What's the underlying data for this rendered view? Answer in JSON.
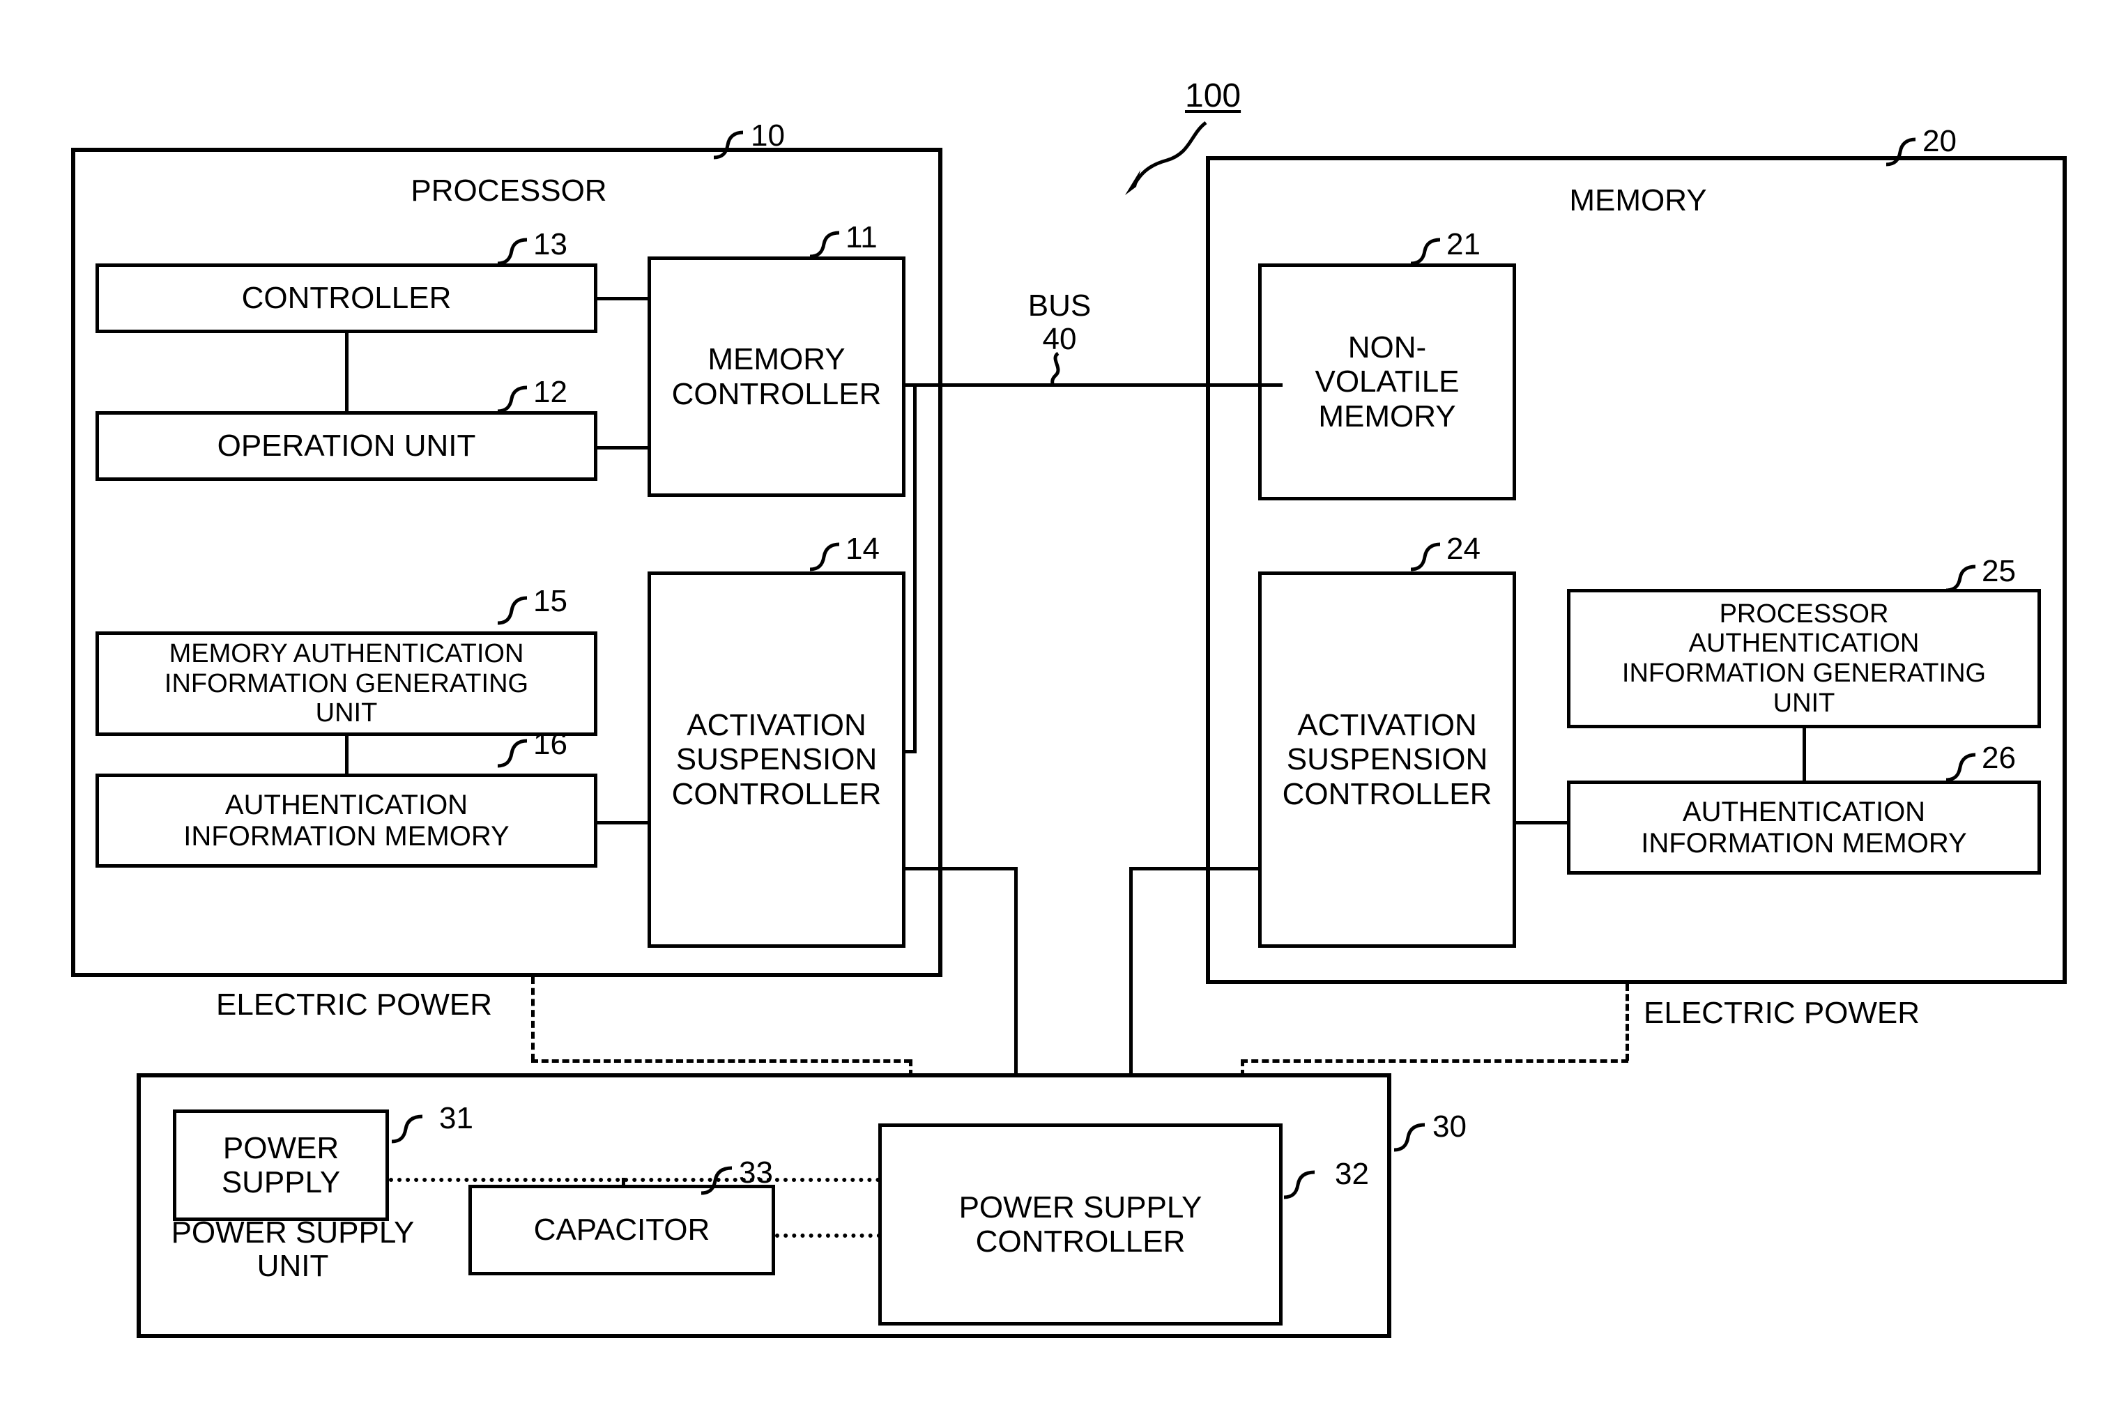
{
  "figure": {
    "system_ref": "100",
    "bus_label": "BUS",
    "bus_ref": "40",
    "electric_power_left": "ELECTRIC POWER",
    "electric_power_right": "ELECTRIC POWER"
  },
  "processor": {
    "title": "PROCESSOR",
    "ref": "10",
    "blocks": [
      {
        "key": "controller",
        "label": "CONTROLLER",
        "ref": "13"
      },
      {
        "key": "operation_unit",
        "label": "OPERATION UNIT",
        "ref": "12"
      },
      {
        "key": "memory_controller",
        "label": "MEMORY\nCONTROLLER",
        "ref": "11"
      },
      {
        "key": "activation_susp",
        "label": "ACTIVATION\nSUSPENSION\nCONTROLLER",
        "ref": "14"
      },
      {
        "key": "mem_auth_gen",
        "label": "MEMORY AUTHENTICATION\nINFORMATION GENERATING\nUNIT",
        "ref": "15"
      },
      {
        "key": "auth_info_mem",
        "label": "AUTHENTICATION\nINFORMATION MEMORY",
        "ref": "16"
      }
    ]
  },
  "memory": {
    "title": "MEMORY",
    "ref": "20",
    "blocks": [
      {
        "key": "nonvolatile",
        "label": "NON-\nVOLATILE\nMEMORY",
        "ref": "21"
      },
      {
        "key": "activation_susp",
        "label": "ACTIVATION\nSUSPENSION\nCONTROLLER",
        "ref": "24"
      },
      {
        "key": "proc_auth_gen",
        "label": "PROCESSOR\nAUTHENTICATION\nINFORMATION GENERATING\nUNIT",
        "ref": "25"
      },
      {
        "key": "auth_info_mem",
        "label": "AUTHENTICATION\nINFORMATION MEMORY",
        "ref": "26"
      }
    ]
  },
  "power_supply_unit": {
    "title": "POWER SUPPLY\nUNIT",
    "ref": "30",
    "blocks": [
      {
        "key": "power_supply",
        "label": "POWER\nSUPPLY",
        "ref": "31"
      },
      {
        "key": "capacitor",
        "label": "CAPACITOR",
        "ref": "33"
      },
      {
        "key": "ps_controller",
        "label": "POWER SUPPLY\nCONTROLLER",
        "ref": "32"
      }
    ]
  },
  "colors": {
    "ink": "#000000",
    "paper": "#ffffff"
  }
}
